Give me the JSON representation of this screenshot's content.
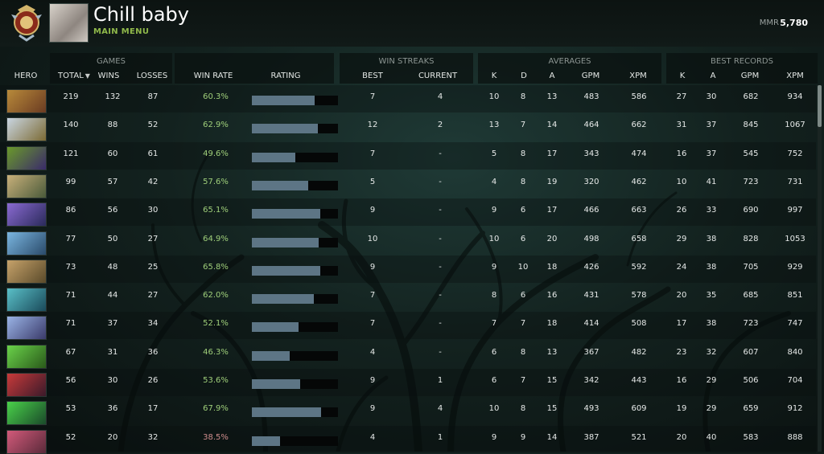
{
  "header": {
    "player_name": "Chill baby",
    "main_menu": "MAIN MENU",
    "mmr_label": "MMR",
    "mmr_value": "5,780"
  },
  "groups": {
    "games": "GAMES",
    "win_streaks": "WIN STREAKS",
    "averages": "AVERAGES",
    "best_records": "BEST RECORDS"
  },
  "columns": {
    "hero": "HERO",
    "total": "TOTAL",
    "wins": "WINS",
    "losses": "LOSSES",
    "win_rate": "WIN RATE",
    "rating": "RATING",
    "best": "BEST",
    "current": "CURRENT",
    "avg_k": "K",
    "avg_d": "D",
    "avg_a": "A",
    "avg_gpm": "GPM",
    "avg_xpm": "XPM",
    "rec_k": "K",
    "rec_a": "A",
    "rec_gpm": "GPM",
    "rec_xpm": "XPM"
  },
  "rows": [
    {
      "total": "219",
      "wins": "132",
      "losses": "87",
      "win_rate": "60.3%",
      "rating": 0.73,
      "best": "7",
      "current": "4",
      "k": "10",
      "d": "8",
      "a": "13",
      "gpm": "483",
      "xpm": "586",
      "rk": "27",
      "ra": "30",
      "rgpm": "682",
      "rxpm": "934",
      "hero_color": "#b88a3a",
      "hero_color2": "#6b3b22"
    },
    {
      "total": "140",
      "wins": "88",
      "losses": "52",
      "win_rate": "62.9%",
      "rating": 0.77,
      "best": "12",
      "current": "2",
      "k": "13",
      "d": "7",
      "a": "14",
      "gpm": "464",
      "xpm": "662",
      "rk": "31",
      "ra": "37",
      "rgpm": "845",
      "rxpm": "1067",
      "hero_color": "#c9d6e2",
      "hero_color2": "#7c6a34"
    },
    {
      "total": "121",
      "wins": "60",
      "losses": "61",
      "win_rate": "49.6%",
      "rating": 0.5,
      "best": "7",
      "current": "-",
      "k": "5",
      "d": "8",
      "a": "17",
      "gpm": "343",
      "xpm": "474",
      "rk": "16",
      "ra": "37",
      "rgpm": "545",
      "rxpm": "752",
      "hero_color": "#6a9a2a",
      "hero_color2": "#3a2a6a"
    },
    {
      "total": "99",
      "wins": "57",
      "losses": "42",
      "win_rate": "57.6%",
      "rating": 0.65,
      "best": "5",
      "current": "-",
      "k": "4",
      "d": "8",
      "a": "19",
      "gpm": "320",
      "xpm": "462",
      "rk": "10",
      "ra": "41",
      "rgpm": "723",
      "rxpm": "731",
      "hero_color": "#c8b07a",
      "hero_color2": "#4a5a3a"
    },
    {
      "total": "86",
      "wins": "56",
      "losses": "30",
      "win_rate": "65.1%",
      "rating": 0.79,
      "best": "9",
      "current": "-",
      "k": "9",
      "d": "6",
      "a": "17",
      "gpm": "466",
      "xpm": "663",
      "rk": "26",
      "ra": "33",
      "rgpm": "690",
      "rxpm": "997",
      "hero_color": "#8a6ad2",
      "hero_color2": "#2a2a5a"
    },
    {
      "total": "77",
      "wins": "50",
      "losses": "27",
      "win_rate": "64.9%",
      "rating": 0.78,
      "best": "10",
      "current": "-",
      "k": "10",
      "d": "6",
      "a": "20",
      "gpm": "498",
      "xpm": "658",
      "rk": "29",
      "ra": "38",
      "rgpm": "828",
      "rxpm": "1053",
      "hero_color": "#7ab6e0",
      "hero_color2": "#2a4a6a"
    },
    {
      "total": "73",
      "wins": "48",
      "losses": "25",
      "win_rate": "65.8%",
      "rating": 0.79,
      "best": "9",
      "current": "-",
      "k": "9",
      "d": "10",
      "a": "18",
      "gpm": "426",
      "xpm": "592",
      "rk": "24",
      "ra": "38",
      "rgpm": "705",
      "rxpm": "929",
      "hero_color": "#c6a26a",
      "hero_color2": "#5a4a2a"
    },
    {
      "total": "71",
      "wins": "44",
      "losses": "27",
      "win_rate": "62.0%",
      "rating": 0.72,
      "best": "7",
      "current": "-",
      "k": "8",
      "d": "6",
      "a": "16",
      "gpm": "431",
      "xpm": "578",
      "rk": "20",
      "ra": "35",
      "rgpm": "685",
      "rxpm": "851",
      "hero_color": "#5ac0c8",
      "hero_color2": "#1a4a5a"
    },
    {
      "total": "71",
      "wins": "37",
      "losses": "34",
      "win_rate": "52.1%",
      "rating": 0.54,
      "best": "7",
      "current": "-",
      "k": "7",
      "d": "7",
      "a": "18",
      "gpm": "414",
      "xpm": "508",
      "rk": "17",
      "ra": "38",
      "rgpm": "723",
      "rxpm": "747",
      "hero_color": "#9ab4e6",
      "hero_color2": "#3a3a6a"
    },
    {
      "total": "67",
      "wins": "31",
      "losses": "36",
      "win_rate": "46.3%",
      "rating": 0.44,
      "best": "4",
      "current": "-",
      "k": "6",
      "d": "8",
      "a": "13",
      "gpm": "367",
      "xpm": "482",
      "rk": "23",
      "ra": "32",
      "rgpm": "607",
      "rxpm": "840",
      "hero_color": "#6ad24a",
      "hero_color2": "#2a5a1a"
    },
    {
      "total": "56",
      "wins": "30",
      "losses": "26",
      "win_rate": "53.6%",
      "rating": 0.56,
      "best": "9",
      "current": "1",
      "k": "6",
      "d": "7",
      "a": "15",
      "gpm": "342",
      "xpm": "443",
      "rk": "16",
      "ra": "29",
      "rgpm": "506",
      "rxpm": "704",
      "hero_color": "#c83a3a",
      "hero_color2": "#3a1a2a"
    },
    {
      "total": "53",
      "wins": "36",
      "losses": "17",
      "win_rate": "67.9%",
      "rating": 0.8,
      "best": "9",
      "current": "4",
      "k": "10",
      "d": "8",
      "a": "15",
      "gpm": "493",
      "xpm": "609",
      "rk": "19",
      "ra": "29",
      "rgpm": "659",
      "rxpm": "912",
      "hero_color": "#4ad24a",
      "hero_color2": "#1a4a2a"
    },
    {
      "total": "52",
      "wins": "20",
      "losses": "32",
      "win_rate": "38.5%",
      "rating": 0.33,
      "best": "4",
      "current": "1",
      "k": "9",
      "d": "9",
      "a": "14",
      "gpm": "387",
      "xpm": "521",
      "rk": "20",
      "ra": "40",
      "rgpm": "583",
      "rxpm": "888",
      "hero_color": "#d25a7a",
      "hero_color2": "#5a2a3a"
    }
  ],
  "icons": {
    "badge": "immortal-rank-badge-icon",
    "sort": "chevron-down-icon"
  }
}
